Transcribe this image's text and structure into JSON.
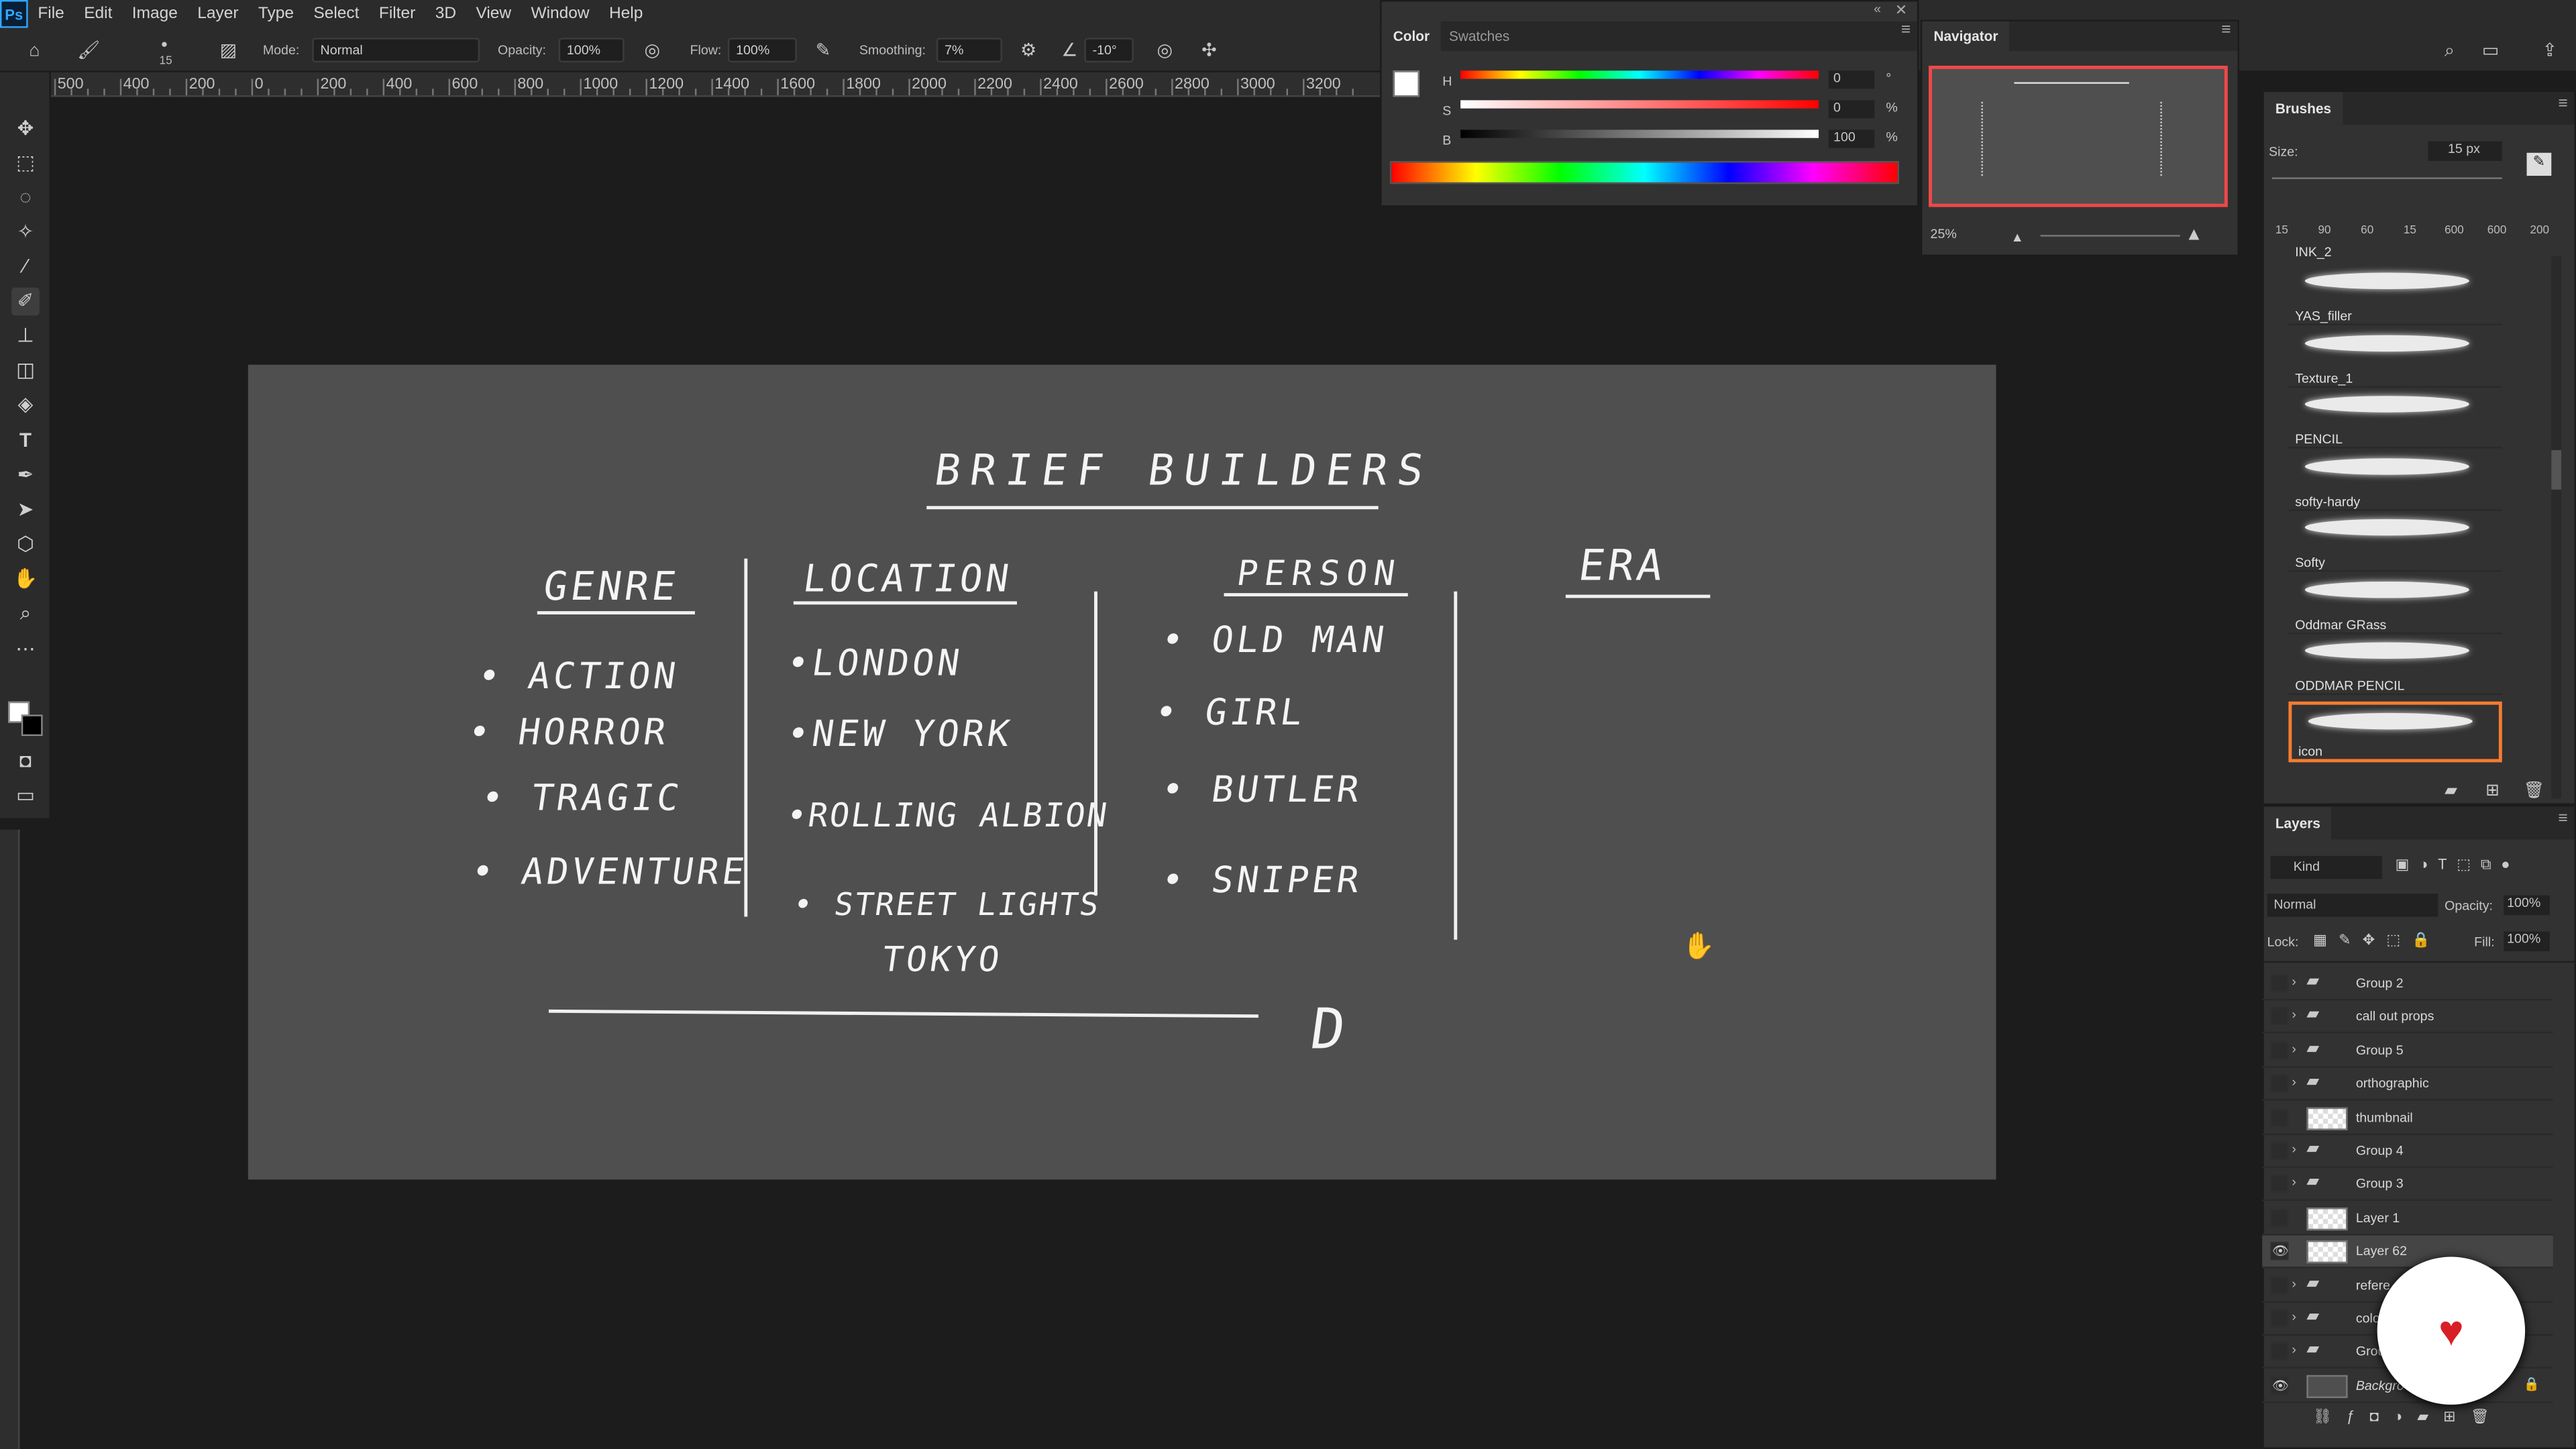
{
  "menu": {
    "logo": "Ps",
    "items": [
      "File",
      "Edit",
      "Image",
      "Layer",
      "Type",
      "Select",
      "Filter",
      "3D",
      "View",
      "Window",
      "Help"
    ]
  },
  "options": {
    "brush_size": "15",
    "mode_label": "Mode:",
    "mode_value": "Normal",
    "opacity_label": "Opacity:",
    "opacity_value": "100%",
    "flow_label": "Flow:",
    "flow_value": "100%",
    "smoothing_label": "Smoothing:",
    "smoothing_value": "7%",
    "angle_value": "-10°"
  },
  "ruler": {
    "labels": [
      "500",
      "400",
      "200",
      "0",
      "200",
      "400",
      "600",
      "800",
      "1000",
      "1200",
      "1400",
      "1600",
      "1800",
      "2000",
      "2200",
      "2400",
      "2600",
      "2800",
      "3000",
      "3200"
    ]
  },
  "canvas": {
    "title": "BRIEF BUILDERS",
    "columns": [
      {
        "header": "GENRE",
        "items": [
          "• ACTION",
          "• HORROR",
          "• TRAGIC",
          "• ADVENTURE"
        ]
      },
      {
        "header": "LOCATION",
        "items": [
          "•LONDON",
          "•NEW YORK",
          "•ROLLING ALBION",
          "• STREET LIGHTS",
          "TOKYO"
        ]
      },
      {
        "header": "PERSON",
        "items": [
          "• OLD MAN",
          "• GIRL",
          "• BUTLER",
          "• SNIPER"
        ]
      },
      {
        "header": "ERA",
        "items": []
      }
    ],
    "bottom_letter": "D"
  },
  "color_panel": {
    "tabs": [
      "Color",
      "Swatches"
    ],
    "h_label": "H",
    "h_value": "0",
    "h_unit": "°",
    "s_label": "S",
    "s_value": "0",
    "s_unit": "%",
    "b_label": "B",
    "b_value": "100",
    "b_unit": "%"
  },
  "navigator": {
    "tab": "Navigator",
    "zoom": "25%"
  },
  "brushes": {
    "tab": "Brushes",
    "size_label": "Size:",
    "size_value": "15 px",
    "presets": [
      "15",
      "90",
      "60",
      "15",
      "600",
      "600",
      "200"
    ],
    "items": [
      "INK_2",
      "YAS_filler",
      "Texture_1",
      "PENCIL",
      "softy-hardy",
      "Softy",
      "Oddmar GRass",
      "ODDMAR PENCIL",
      "icon"
    ]
  },
  "layers": {
    "tab": "Layers",
    "kind": "Kind",
    "blend": "Normal",
    "opacity_label": "Opacity:",
    "opacity_value": "100%",
    "lock_label": "Lock:",
    "fill_label": "Fill:",
    "fill_value": "100%",
    "items": [
      {
        "name": "Group 2",
        "type": "group",
        "visible": false
      },
      {
        "name": "call out props",
        "type": "group",
        "visible": false
      },
      {
        "name": "Group 5",
        "type": "group",
        "visible": false
      },
      {
        "name": "orthographic",
        "type": "group",
        "visible": false
      },
      {
        "name": "thumbnail",
        "type": "layer",
        "visible": false
      },
      {
        "name": "Group 4",
        "type": "group",
        "visible": false
      },
      {
        "name": "Group 3",
        "type": "group",
        "visible": false
      },
      {
        "name": "Layer 1",
        "type": "layer",
        "visible": false
      },
      {
        "name": "Layer 62",
        "type": "layer",
        "visible": true,
        "selected": true
      },
      {
        "name": "refere",
        "type": "group",
        "visible": false
      },
      {
        "name": "colo",
        "type": "group",
        "visible": false
      },
      {
        "name": "Grou",
        "type": "group",
        "visible": false
      },
      {
        "name": "Backgro",
        "type": "background",
        "visible": true
      }
    ]
  },
  "colors": {
    "accent": "#f47c30",
    "brand_badge": "#d81f26"
  }
}
